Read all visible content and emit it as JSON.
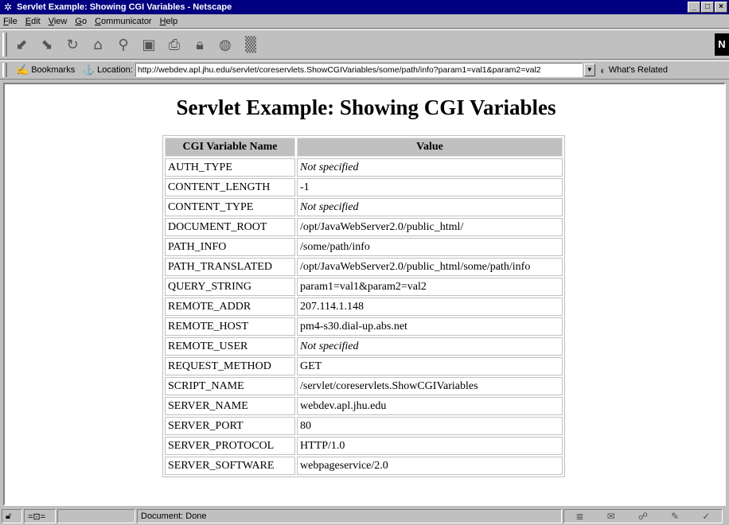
{
  "window": {
    "title": "Servlet Example: Showing CGI Variables - Netscape",
    "app_icon": "netscape-icon",
    "controls": [
      "minimize",
      "maximize",
      "close"
    ]
  },
  "menu": {
    "items": [
      "File",
      "Edit",
      "View",
      "Go",
      "Communicator",
      "Help"
    ]
  },
  "toolbar": {
    "buttons": [
      "back-icon",
      "forward-icon",
      "reload-icon",
      "home-icon",
      "search-icon",
      "my-netscape-icon",
      "print-icon",
      "security-icon",
      "shop-icon",
      "stop-icon"
    ],
    "logo_letter": "N"
  },
  "location_bar": {
    "bookmarks_label": "Bookmarks",
    "location_label": "Location:",
    "url": "http://webdev.apl.jhu.edu/servlet/coreservlets.ShowCGIVariables/some/path/info?param1=val1&param2=val2",
    "related_label": "What's Related"
  },
  "page": {
    "heading": "Servlet Example: Showing CGI Variables",
    "table": {
      "headers": [
        "CGI Variable Name",
        "Value"
      ],
      "rows": [
        {
          "name": "AUTH_TYPE",
          "value": "Not specified"
        },
        {
          "name": "CONTENT_LENGTH",
          "value": "-1"
        },
        {
          "name": "CONTENT_TYPE",
          "value": "Not specified"
        },
        {
          "name": "DOCUMENT_ROOT",
          "value": "/opt/JavaWebServer2.0/public_html/"
        },
        {
          "name": "PATH_INFO",
          "value": "/some/path/info"
        },
        {
          "name": "PATH_TRANSLATED",
          "value": "/opt/JavaWebServer2.0/public_html/some/path/info"
        },
        {
          "name": "QUERY_STRING",
          "value": "param1=val1&param2=val2"
        },
        {
          "name": "REMOTE_ADDR",
          "value": "207.114.1.148"
        },
        {
          "name": "REMOTE_HOST",
          "value": "pm4-s30.dial-up.abs.net"
        },
        {
          "name": "REMOTE_USER",
          "value": "Not specified"
        },
        {
          "name": "REQUEST_METHOD",
          "value": "GET"
        },
        {
          "name": "SCRIPT_NAME",
          "value": "/servlet/coreservlets.ShowCGIVariables"
        },
        {
          "name": "SERVER_NAME",
          "value": "webdev.apl.jhu.edu"
        },
        {
          "name": "SERVER_PORT",
          "value": "80"
        },
        {
          "name": "SERVER_PROTOCOL",
          "value": "HTTP/1.0"
        },
        {
          "name": "SERVER_SOFTWARE",
          "value": "webpageservice/2.0"
        }
      ]
    }
  },
  "status": {
    "text": "Document: Done"
  },
  "colors": {
    "titlebar": "#000080",
    "chrome": "#c0c0c0",
    "page_bg": "#ffffff"
  }
}
